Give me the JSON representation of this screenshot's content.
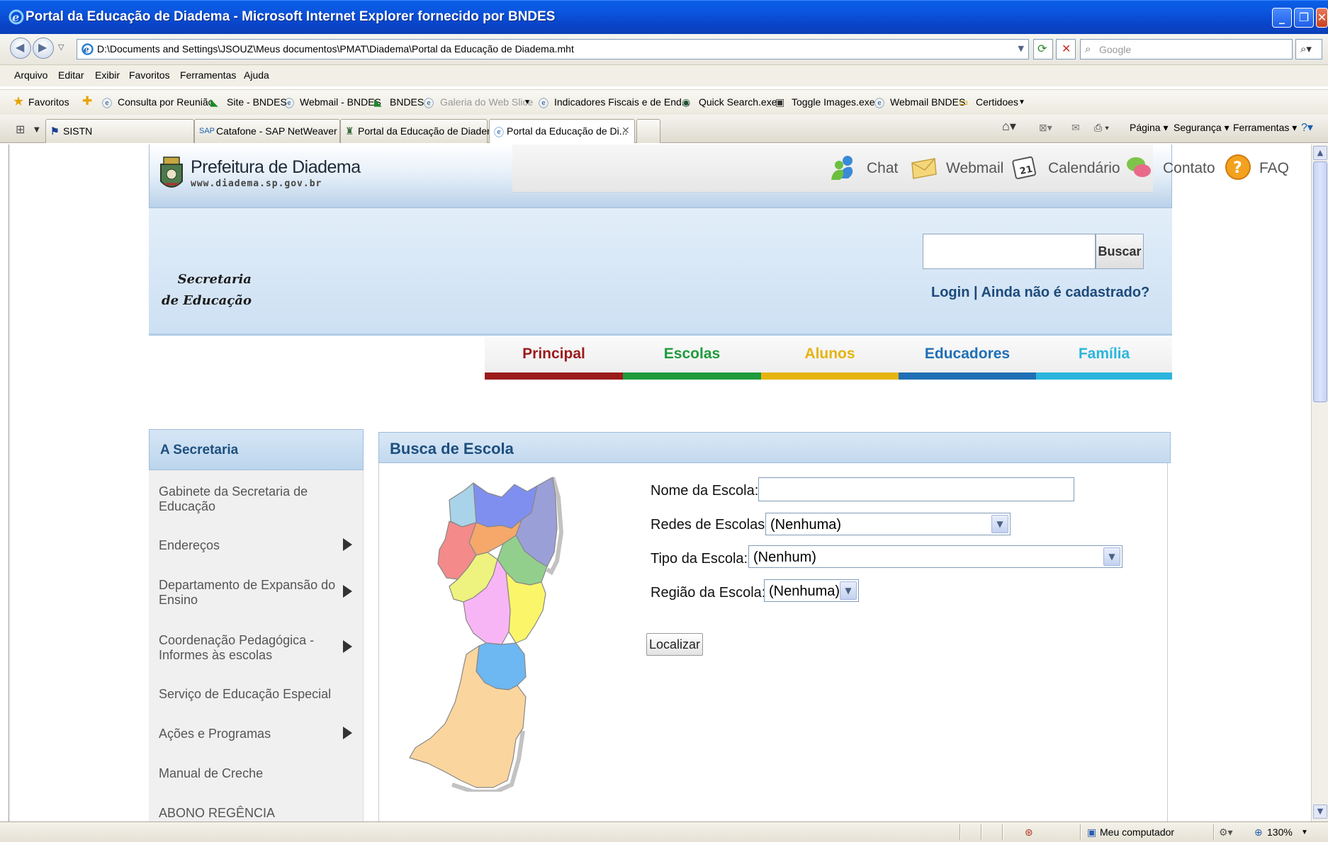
{
  "window": {
    "title": "Portal da Educação de Diadema - Microsoft Internet Explorer fornecido por BNDES"
  },
  "address_bar": {
    "url": "D:\\Documents and Settings\\JSOUZ\\Meus documentos\\PMAT\\Diadema\\Portal da Educação de Diadema.mht",
    "search_placeholder": "Google"
  },
  "menu": [
    "Arquivo",
    "Editar",
    "Exibir",
    "Favoritos",
    "Ferramentas",
    "Ajuda"
  ],
  "favorites": {
    "label": "Favoritos",
    "items": [
      "Consulta por Reunião",
      "Site - BNDES",
      "Webmail - BNDES",
      "BNDES",
      "Galeria do Web Slice",
      "Indicadores Fiscais e de End...",
      "Quick Search.exe",
      "Toggle Images.exe",
      "Webmail BNDES",
      "Certidoes"
    ]
  },
  "tabs": [
    "SISTN",
    "Catafone - SAP NetWeaver ...",
    "Portal da Educação de Diadema",
    "Portal da Educação de Di..."
  ],
  "command_bar": [
    "Página",
    "Segurança",
    "Ferramentas"
  ],
  "site": {
    "logo_title": "Prefeitura de Diadema",
    "logo_url": "www.diadema.sp.gov.br",
    "quick_links": [
      "Chat",
      "Webmail",
      "Calendário",
      "Contato",
      "FAQ"
    ],
    "section_title_line1": "Secretaria",
    "section_title_line2": "de Educação",
    "search_button": "Buscar",
    "login": "Login",
    "separator": "|",
    "register": "Ainda não é cadastrado?",
    "nav": [
      {
        "label": "Principal",
        "color": "#9b1b1b"
      },
      {
        "label": "Escolas",
        "color": "#1f9a3c"
      },
      {
        "label": "Alunos",
        "color": "#e5b40e"
      },
      {
        "label": "Educadores",
        "color": "#1f6fb5"
      },
      {
        "label": "Família",
        "color": "#2bb5de"
      }
    ]
  },
  "sidebar": {
    "heading": "A Secretaria",
    "items": [
      {
        "label": "Gabinete da Secretaria de Educação",
        "arrow": false
      },
      {
        "label": "Endereços",
        "arrow": true
      },
      {
        "label": "Departamento de Expansão do Ensino",
        "arrow": true
      },
      {
        "label": "Coordenação Pedagógica - Informes às escolas",
        "arrow": true
      },
      {
        "label": "Serviço de Educação Especial",
        "arrow": false
      },
      {
        "label": "Ações e Programas",
        "arrow": true
      },
      {
        "label": "Manual de Creche",
        "arrow": false
      },
      {
        "label": "ABONO REGÊNCIA",
        "arrow": false
      }
    ]
  },
  "main": {
    "heading": "Busca de Escola",
    "form": {
      "school_name_label": "Nome da Escola:",
      "school_name_value": "",
      "network_label": "Redes de Escolas:",
      "network_value": "(Nenhuma)",
      "type_label": "Tipo da Escola:",
      "type_value": "(Nenhum)",
      "region_label": "Região da Escola:",
      "region_value": "(Nenhuma)",
      "submit": "Localizar"
    }
  },
  "statusbar": {
    "zone": "Meu computador",
    "zoom": "130%"
  }
}
